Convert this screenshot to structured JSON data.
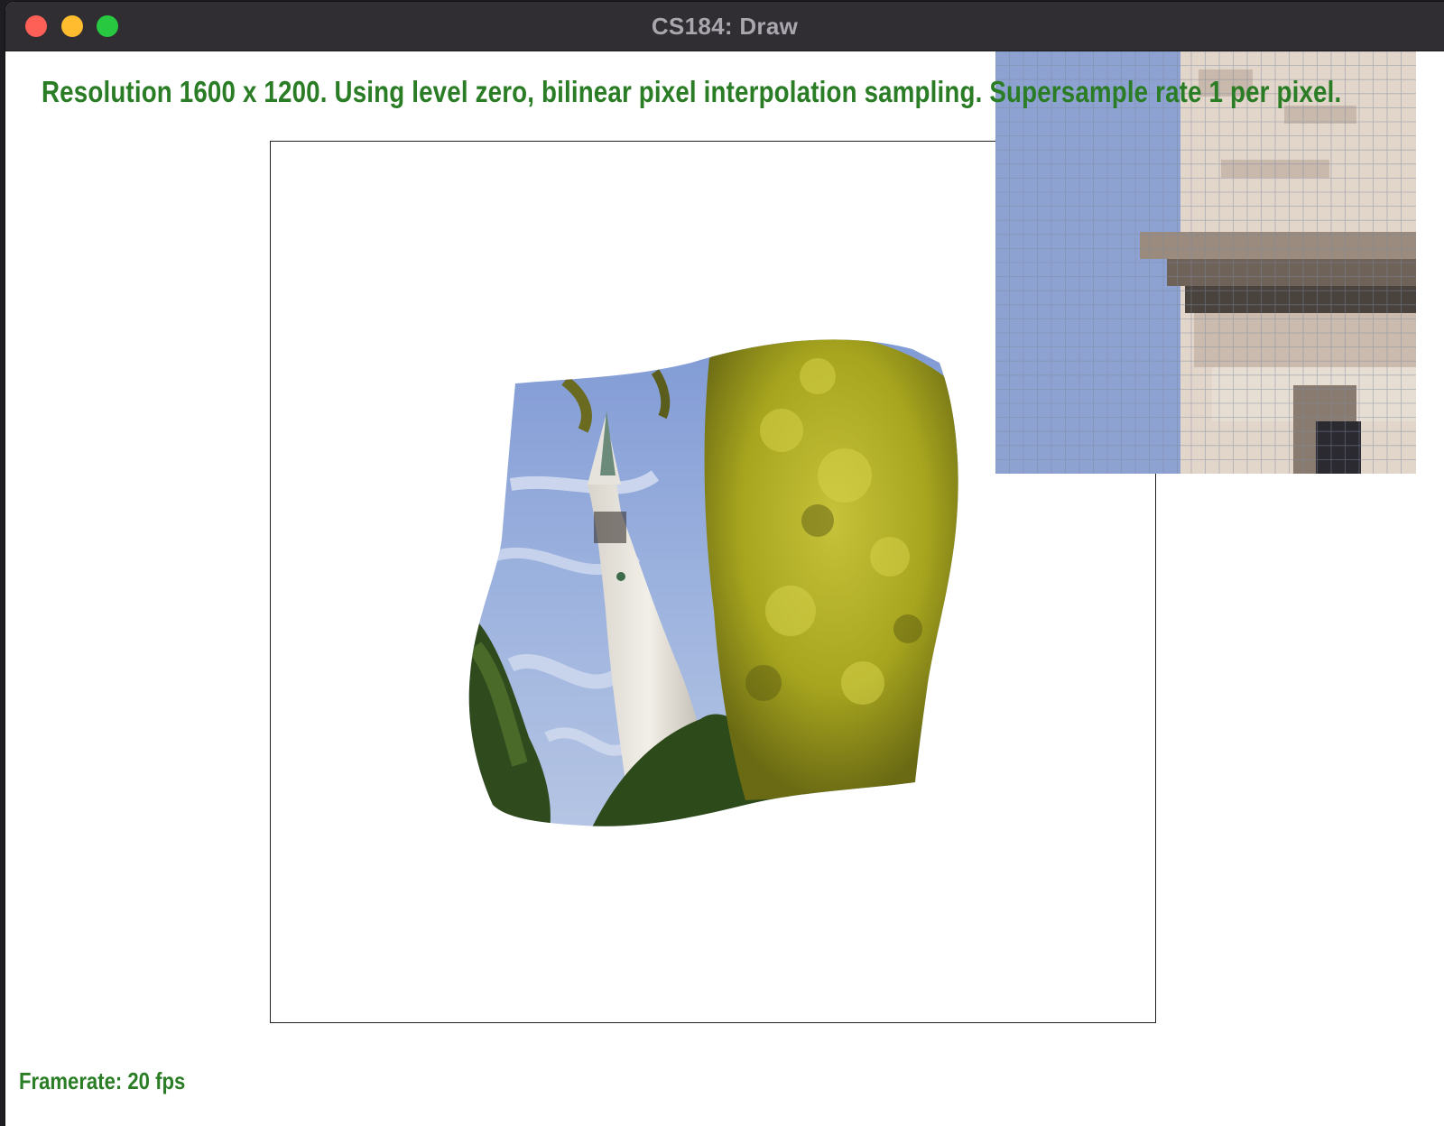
{
  "window": {
    "title": "CS184: Draw"
  },
  "overlay": {
    "status": "Resolution 1600 x 1200. Using level zero, bilinear pixel interpolation sampling. Supersample rate 1 per pixel.",
    "framerate": "Framerate: 20 fps"
  },
  "colors": {
    "text_green": "#2a7d25",
    "titlebar": "#302d33",
    "sky": "#8fa3d3"
  },
  "icons": [
    "close-icon",
    "minimize-icon",
    "maximize-icon"
  ]
}
